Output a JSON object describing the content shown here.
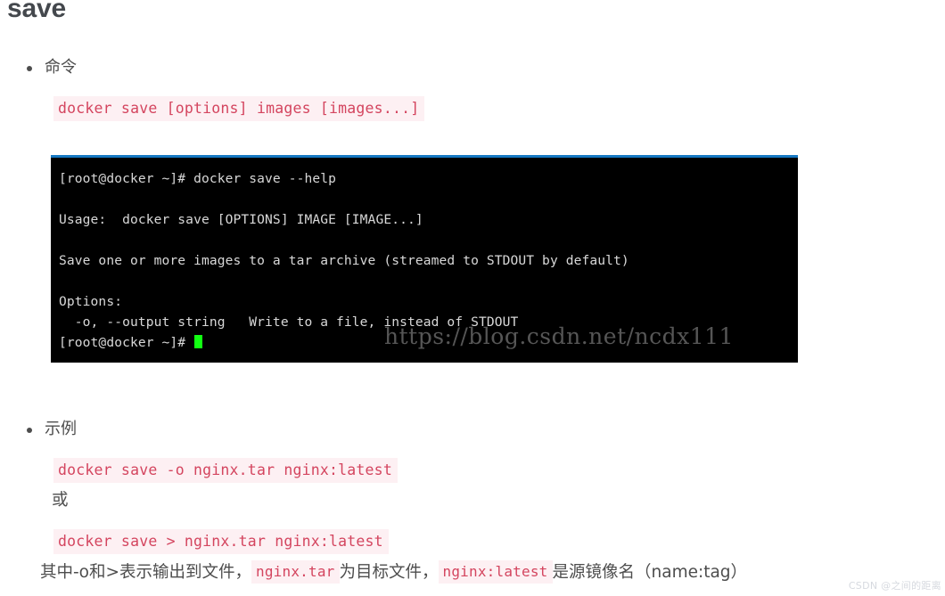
{
  "page": {
    "title": "save",
    "background_color": "#ffffff",
    "text_color": "#4d4d4d"
  },
  "sections": [
    {
      "bullet_label": "命令",
      "code": "docker save [options] images [images...]"
    },
    {
      "bullet_label": "示例",
      "code_1": "docker save -o nginx.tar nginx:latest",
      "separator_text": "或",
      "code_2": "docker save > nginx.tar nginx:latest"
    }
  ],
  "terminal": {
    "accent_border_color": "#1678c2",
    "background_color": "#000000",
    "text_color": "#d8d8d8",
    "cursor_color": "#12ff12",
    "lines": [
      "[root@docker ~]# docker save --help",
      "",
      "Usage:  docker save [OPTIONS] IMAGE [IMAGE...]",
      "",
      "Save one or more images to a tar archive (streamed to STDOUT by default)",
      "",
      "Options:",
      "  -o, --output string   Write to a file, instead of STDOUT",
      "[root@docker ~]# "
    ],
    "watermark": "https://blog.csdn.net/ncdx111"
  },
  "explanation": {
    "part_1": "其中-o和>表示输出到文件，",
    "code_1": "nginx.tar",
    "part_2": "为目标文件，",
    "code_2": "nginx:latest",
    "part_3": "是源镜像名（name:tag）"
  },
  "corner_watermark": "CSDN @之间的距离",
  "colors": {
    "inline_code_background": "#fdf0f3",
    "inline_code_text": "#d4455f",
    "heading": "#44484d"
  }
}
